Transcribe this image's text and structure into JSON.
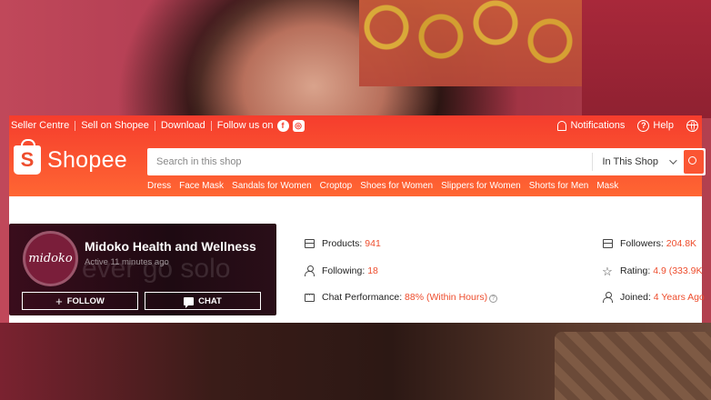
{
  "topbar": {
    "links": [
      "Seller Centre",
      "Sell on Shopee",
      "Download"
    ],
    "follow_label": "Follow us on",
    "notifications_label": "Notifications",
    "help_label": "Help"
  },
  "brand": {
    "name": "Shopee"
  },
  "search": {
    "placeholder": "Search in this shop",
    "scope_label": "In This Shop"
  },
  "categories": [
    "Dress",
    "Face Mask",
    "Sandals for Women",
    "Croptop",
    "Shoes for Women",
    "Slippers for Women",
    "Shorts for Men",
    "Mask"
  ],
  "shop": {
    "name": "Midoko Health and Wellness",
    "active_status": "Active 11 minutes ago",
    "avatar_text": "midoko",
    "banner_watermark": "ever go solo",
    "follow_label": "FOLLOW",
    "chat_label": "CHAT"
  },
  "stats": {
    "products": {
      "label": "Products:",
      "value": "941"
    },
    "following": {
      "label": "Following:",
      "value": "18"
    },
    "chat_performance": {
      "label": "Chat Performance:",
      "value": "88% (Within Hours)"
    },
    "followers": {
      "label": "Followers:",
      "value": "204.8K"
    },
    "rating": {
      "label": "Rating:",
      "value": "4.9 (333.9K"
    },
    "joined": {
      "label": "Joined:",
      "value": "4 Years Ago"
    }
  },
  "colors": {
    "brand_orange": "#ee4d2d",
    "header_gradient_start": "#f53d2d",
    "header_gradient_end": "#ff6633"
  }
}
